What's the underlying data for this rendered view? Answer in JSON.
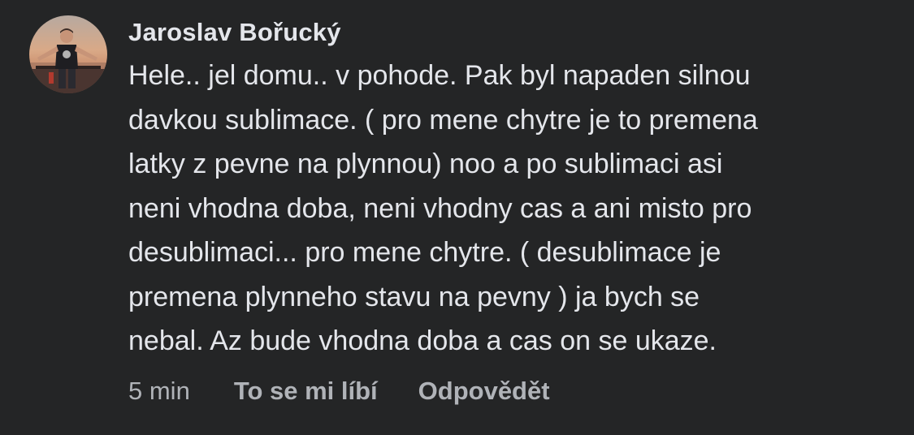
{
  "comment": {
    "author": "Jaroslav Bořucký",
    "avatar_icon": "user-profile-photo",
    "text_lines": [
      "Hele.. jel domu.. v pohode. Pak byl napaden silnou",
      "davkou sublimace. ( pro mene chytre je to premena",
      "latky z pevne na plynnou) noo a po sublimaci asi",
      "neni vhodna doba, neni vhodny cas a ani misto pro",
      "desublimaci... pro mene chytre. ( desublimace je",
      "premena plynneho stavu na pevny ) ja bych se",
      "nebal. Az bude vhodna doba a cas on se ukaze."
    ],
    "timestamp": "5 min",
    "like_label": "To se mi líbí",
    "reply_label": "Odpovědět"
  },
  "colors": {
    "background": "#242526",
    "primary_text": "#e4e6eb",
    "secondary_text": "#b0b3b8"
  }
}
